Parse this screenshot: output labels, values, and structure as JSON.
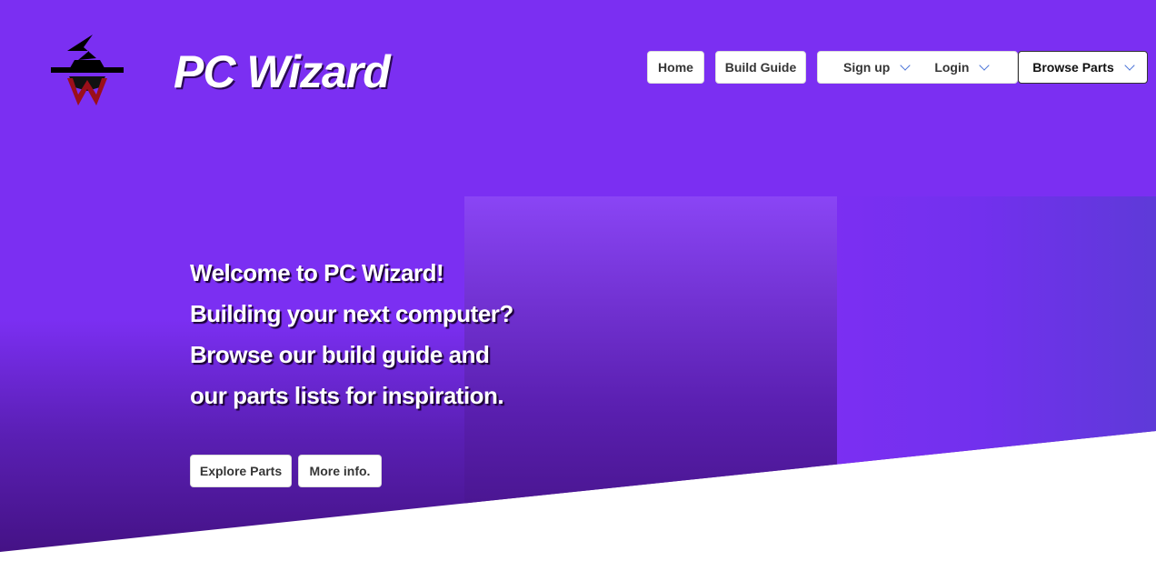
{
  "header": {
    "brand": "PC Wizard",
    "logo_icon": "wizard-hat-icon"
  },
  "nav": {
    "home": "Home",
    "build_guide": "Build Guide",
    "sign_up": "Sign up",
    "login": "Login",
    "browse_parts": "Browse Parts"
  },
  "hero": {
    "lines": [
      "Welcome to PC Wizard!",
      "Building your next computer?",
      "Browse our build guide and",
      "our parts lists for inspiration."
    ],
    "buttons": {
      "explore": "Explore Parts",
      "more_info": "More info."
    }
  },
  "colors": {
    "primary_purple": "#7b2ff2",
    "dark_purple": "#3f0f7a",
    "logo_red": "#9b0f1a"
  }
}
